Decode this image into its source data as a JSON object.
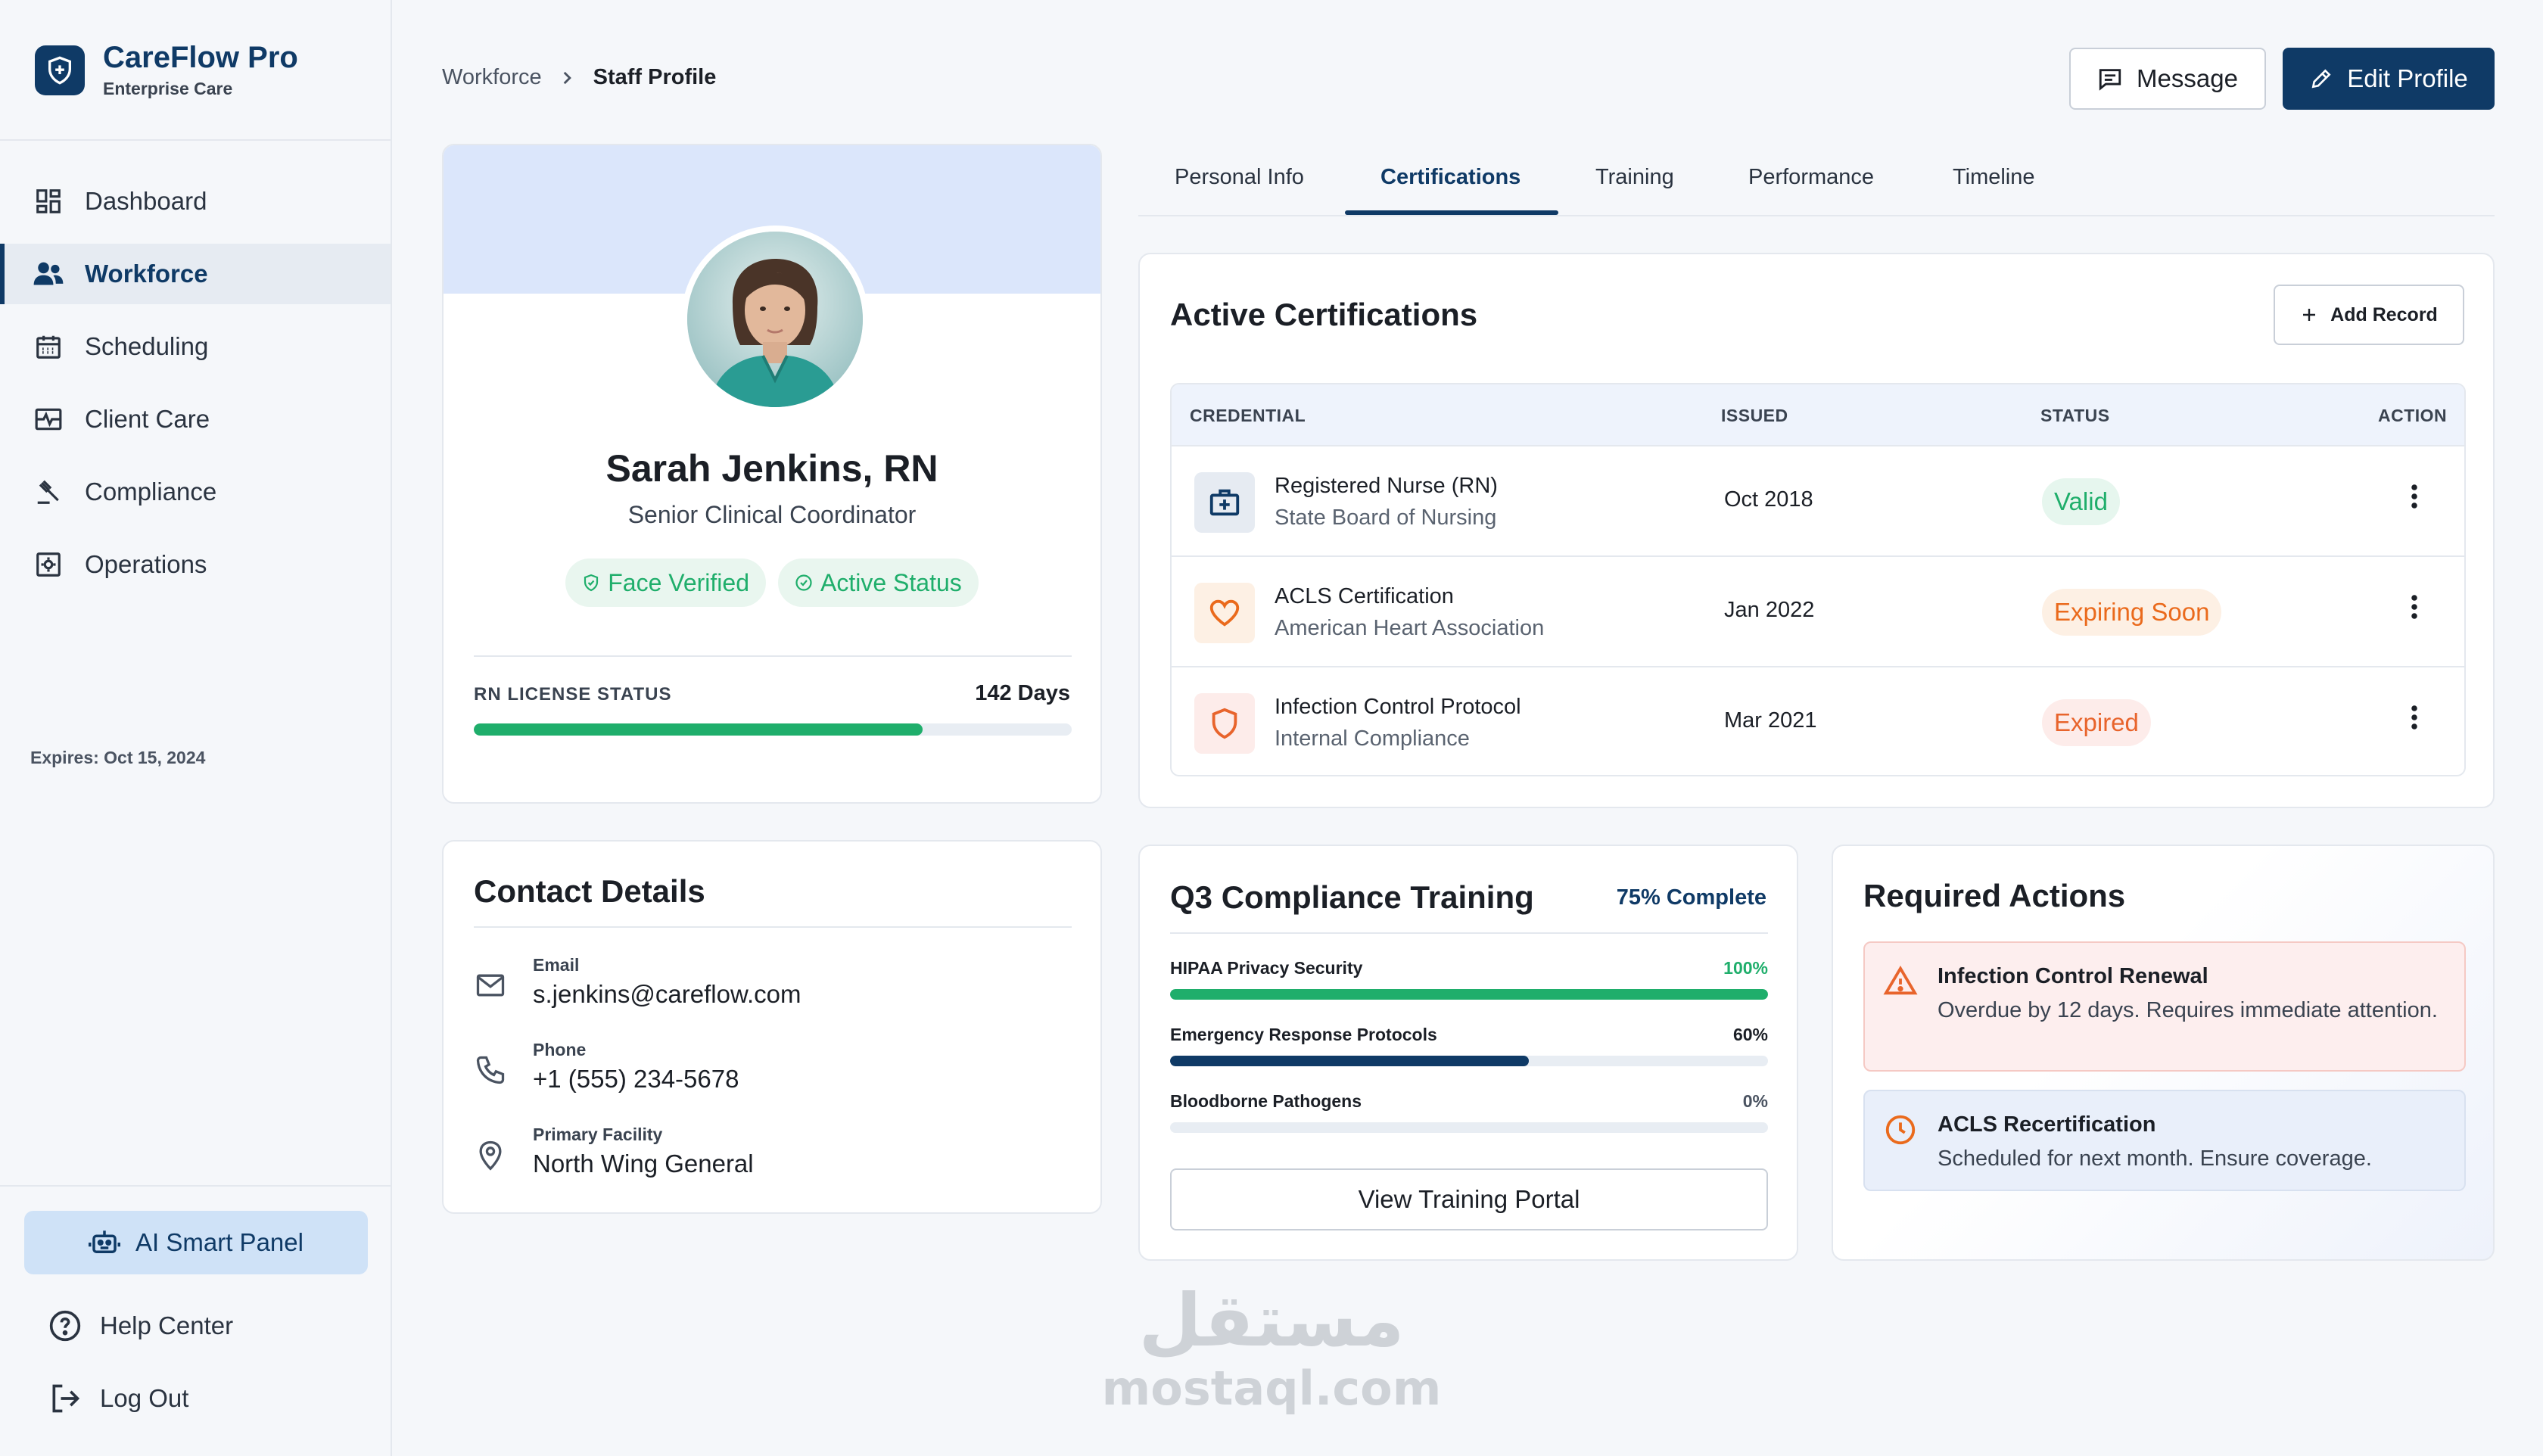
{
  "brand": {
    "name": "CareFlow Pro",
    "subtitle": "Enterprise Care"
  },
  "sidebar": {
    "items": [
      {
        "label": "Dashboard",
        "icon": "dashboard-icon"
      },
      {
        "label": "Workforce",
        "icon": "users-icon",
        "active": true
      },
      {
        "label": "Scheduling",
        "icon": "calendar-icon"
      },
      {
        "label": "Client Care",
        "icon": "activity-icon"
      },
      {
        "label": "Compliance",
        "icon": "gavel-icon"
      },
      {
        "label": "Operations",
        "icon": "settings-box-icon"
      }
    ],
    "ai_button": "AI Smart Panel",
    "help": "Help Center",
    "logout": "Log Out"
  },
  "header": {
    "breadcrumb_root": "Workforce",
    "breadcrumb_current": "Staff Profile",
    "message_label": "Message",
    "edit_label": "Edit Profile"
  },
  "profile": {
    "name": "Sarah Jenkins, RN",
    "role": "Senior Clinical Coordinator",
    "badges": [
      "Face Verified",
      "Active Status"
    ],
    "license_label": "RN LICENSE STATUS",
    "license_days": "142 Days",
    "license_progress": 0.75,
    "license_expires": "Expires: Oct 15, 2024"
  },
  "contact": {
    "title": "Contact Details",
    "email_label": "Email",
    "email": "s.jenkins@careflow.com",
    "phone_label": "Phone",
    "phone": "+1 (555) 234-5678",
    "facility_label": "Primary Facility",
    "facility": "North Wing General"
  },
  "tabs": [
    "Personal Info",
    "Certifications",
    "Training",
    "Performance",
    "Timeline"
  ],
  "active_tab": "Certifications",
  "certifications": {
    "title": "Active Certifications",
    "add_label": "Add Record",
    "columns": [
      "CREDENTIAL",
      "ISSUED",
      "STATUS",
      "ACTION"
    ],
    "rows": [
      {
        "name": "Registered Nurse (RN)",
        "org": "State Board of Nursing",
        "issued": "Oct 2018",
        "status": "Valid",
        "status_color": "#1fae6b",
        "status_bg": "#e6f6ee",
        "icon": "medical-kit-icon"
      },
      {
        "name": "ACLS Certification",
        "org": "American Heart Association",
        "issued": "Jan 2022",
        "status": "Expiring Soon",
        "status_color": "#ea6a1c",
        "status_bg": "#fdf0e4",
        "icon": "heart-icon"
      },
      {
        "name": "Infection Control Protocol",
        "org": "Internal Compliance",
        "issued": "Mar 2021",
        "status": "Expired",
        "status_color": "#e8642c",
        "status_bg": "#fdecea",
        "icon": "shield-icon"
      }
    ]
  },
  "training": {
    "title": "Q3 Compliance Training",
    "complete": "75% Complete",
    "items": [
      {
        "label": "HIPAA Privacy Security",
        "pct": "100%",
        "value": 1.0,
        "color": "#1fae6b",
        "pct_color": "#1fae6b"
      },
      {
        "label": "Emergency Response Protocols",
        "pct": "60%",
        "value": 0.6,
        "color": "#0f3a66",
        "pct_color": "#1b1f26"
      },
      {
        "label": "Bloodborne Pathogens",
        "pct": "0%",
        "value": 0,
        "color": "#0f3a66",
        "pct_color": "#4a5361"
      }
    ],
    "portal_label": "View Training Portal"
  },
  "actions": {
    "title": "Required Actions",
    "items": [
      {
        "title": "Infection Control Renewal",
        "desc": "Overdue by 12 days. Requires immediate attention.",
        "icon": "warning-icon"
      },
      {
        "title": "ACLS Recertification",
        "desc": "Scheduled for next month. Ensure coverage.",
        "icon": "clock-icon"
      }
    ]
  },
  "watermark": {
    "arabic": "مستقل",
    "latin": "mostaql.com"
  },
  "colors": {
    "primary": "#0f3a66",
    "success": "#1fae6b",
    "warning": "#ea6a1c",
    "danger": "#e8642c"
  }
}
